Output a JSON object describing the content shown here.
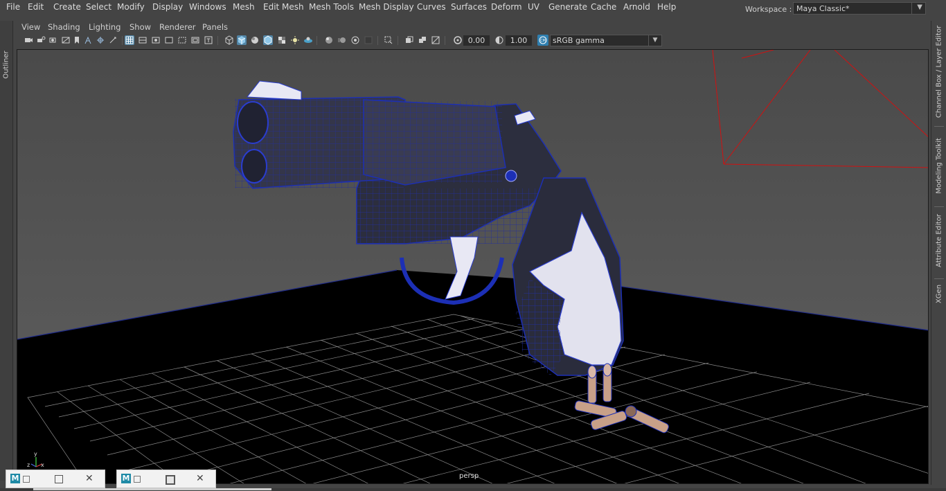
{
  "menu": {
    "items": [
      "File",
      "Edit",
      "Create",
      "Select",
      "Modify",
      "Display",
      "Windows",
      "Mesh",
      "Edit Mesh",
      "Mesh Tools",
      "Mesh Display",
      "Curves",
      "Surfaces",
      "Deform",
      "UV",
      "Generate",
      "Cache",
      "Arnold",
      "Help"
    ]
  },
  "workspace": {
    "label": "Workspace :",
    "value": "Maya Classic*"
  },
  "left_panel": {
    "outliner_tab": "Outliner"
  },
  "right_tabs": [
    "Channel Box / Layer Editor",
    "Modeling Toolkit",
    "Attribute Editor",
    "XGen"
  ],
  "panel_menu": {
    "items": [
      "View",
      "Shading",
      "Lighting",
      "Show",
      "Renderer",
      "Panels"
    ]
  },
  "toolbar": {
    "exposure": "0.00",
    "gamma": "1.00",
    "color_management": "sRGB gamma",
    "icons": [
      "camera-select-icon",
      "camera-attributes-icon",
      "bookmarks-icon",
      "image-plane-icon",
      "film-gate-icon",
      "grid-icon",
      "resolution-gate-icon",
      "gate-mask-icon",
      "field-chart-icon",
      "safe-action-icon",
      "safe-title-icon",
      "wireframe-icon",
      "smooth-shade-icon",
      "use-default-material-icon",
      "wireframe-on-shaded-icon",
      "textured-icon",
      "use-all-lights-icon",
      "shadows-icon",
      "screen-space-ao-icon",
      "motion-blur-icon",
      "anti-aliasing-icon",
      "depth-of-field-icon",
      "isolate-select-icon",
      "xray-icon",
      "xray-active-components-icon",
      "xray-joints-icon",
      "exposure-icon",
      "gamma-icon",
      "color-management-icon"
    ]
  },
  "viewport": {
    "camera": "persp",
    "axis_labels": {
      "x": "x",
      "y": "y",
      "z": "z"
    }
  },
  "taskbar": {
    "windows": [
      {
        "logo": "M",
        "state": "minimized"
      },
      {
        "logo": "M",
        "state": "restored"
      }
    ]
  }
}
